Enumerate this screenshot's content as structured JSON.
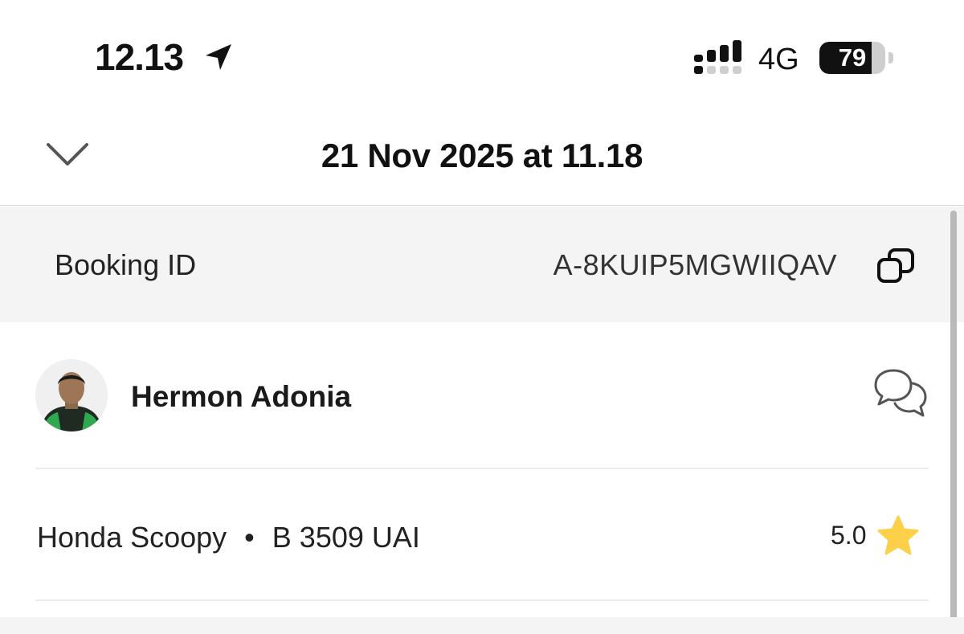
{
  "status_bar": {
    "time": "12.13",
    "network": "4G",
    "battery": "79",
    "battery_level": 0.79,
    "icons": [
      "location-arrow-icon",
      "cellular-signal-icon"
    ]
  },
  "header": {
    "title": "21 Nov 2025 at 11.18",
    "icon": "chevron-down-icon"
  },
  "booking": {
    "label": "Booking ID",
    "id": "A-8KUIP5MGWIIQAV",
    "icon": "copy-icon"
  },
  "driver": {
    "name": "Hermon Adonia",
    "icon": "chat-bubbles-icon"
  },
  "vehicle": {
    "model": "Honda Scoopy",
    "separator": "•",
    "plate": "B 3509 UAI",
    "rating": "5.0",
    "rating_icon": "star-icon",
    "colors": {
      "star": "#fdd04a"
    }
  }
}
